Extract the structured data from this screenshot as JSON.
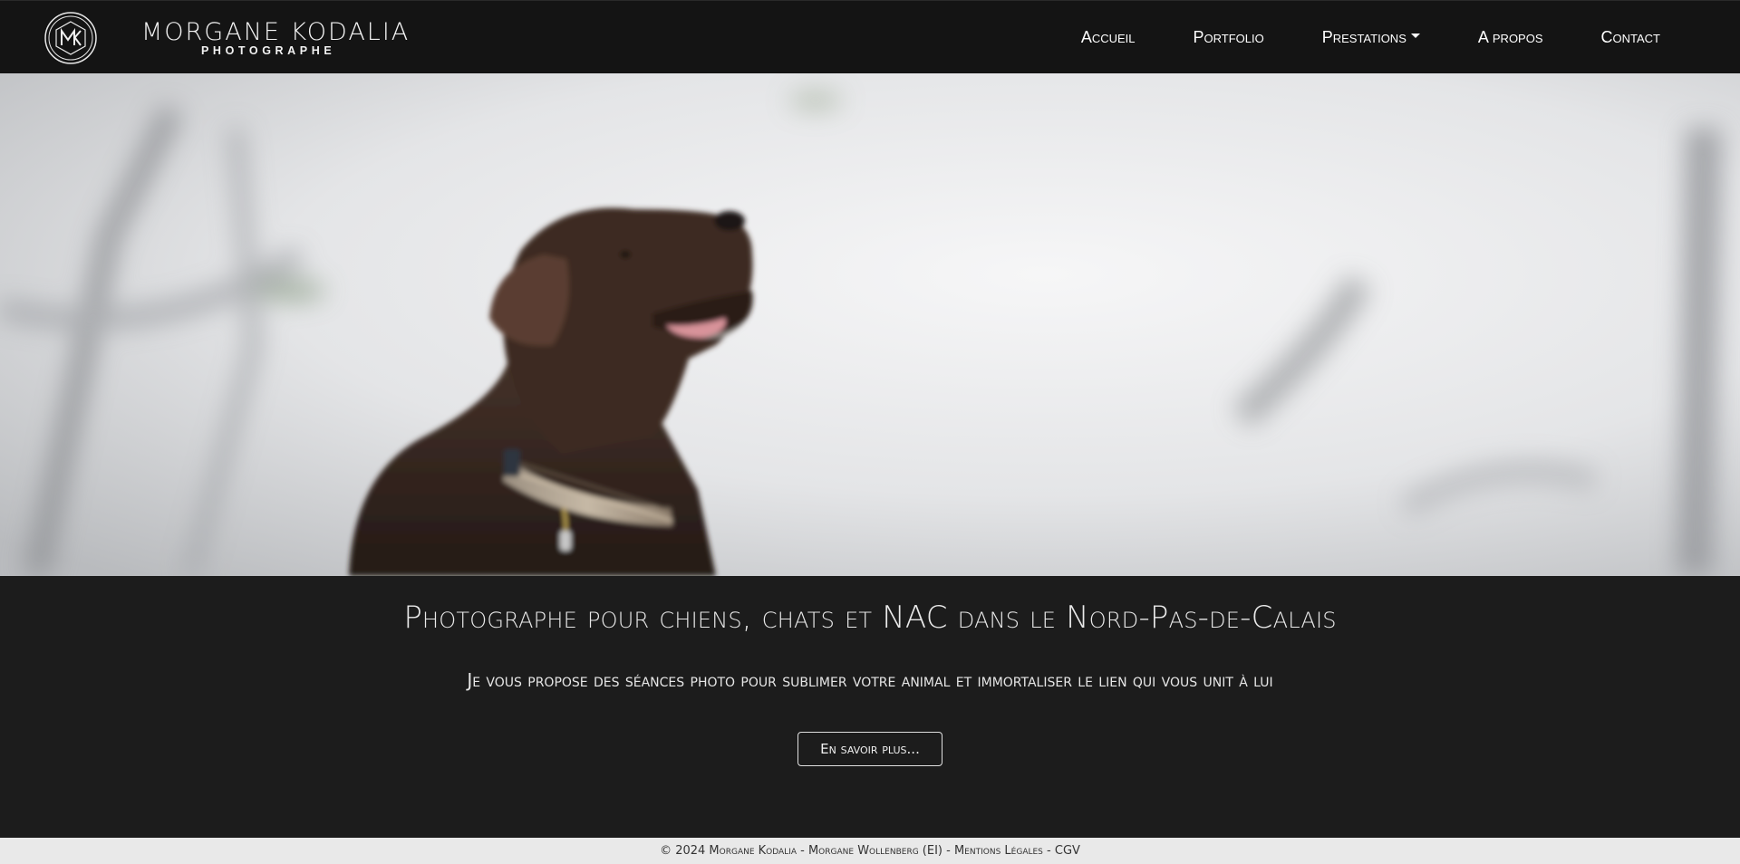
{
  "brand": {
    "name": "MORGANE KODALIA",
    "tagline": "PHOTOGRAPHE",
    "logo_initials": "MK"
  },
  "nav": {
    "items": [
      {
        "label": "Accueil"
      },
      {
        "label": "Portfolio"
      },
      {
        "label": "Prestations",
        "has_dropdown": true
      },
      {
        "label": "A propos"
      },
      {
        "label": "Contact"
      }
    ]
  },
  "hero": {
    "image_subject": "chocolate labrador with plaid collar in snowy forest"
  },
  "main": {
    "headline": "Photographe pour chiens, chats et NAC dans le Nord-Pas-de-Calais",
    "subline": "Je vous propose des séances photo pour sublimer votre animal et immortaliser le lien qui vous unit à lui",
    "cta_label": "En savoir plus..."
  },
  "footer": {
    "copyright": "© 2024 Morgane Kodalia - Morgane Wollenberg (EI) - ",
    "legal_link": "Mentions Légales",
    "separator": " - ",
    "cgv_link": "CGV"
  },
  "colors": {
    "navbar_bg": "#141414",
    "page_bg": "#1c1c1c",
    "footer_bg": "#e9e9e9",
    "text_light": "#ffffff"
  }
}
